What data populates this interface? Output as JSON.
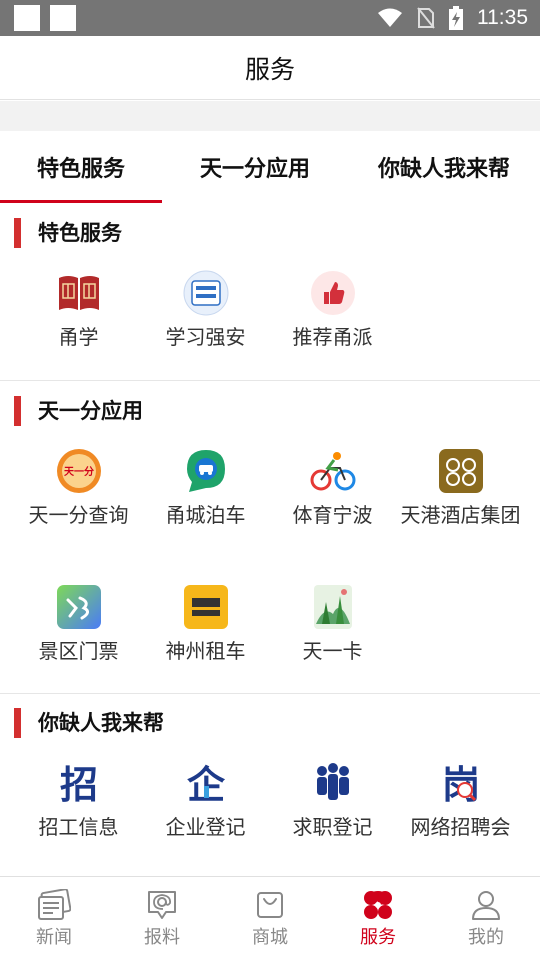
{
  "status_bar": {
    "time": "11:35"
  },
  "header": {
    "title": "服务"
  },
  "tabs": [
    {
      "label": "特色服务",
      "active": true
    },
    {
      "label": "天一分应用",
      "active": false
    },
    {
      "label": "你缺人我来帮",
      "active": false
    }
  ],
  "sections": [
    {
      "title": "特色服务",
      "items": [
        {
          "label": "甬学",
          "icon": "book-icon"
        },
        {
          "label": "学习强安",
          "icon": "study-safety-icon"
        },
        {
          "label": "推荐甬派",
          "icon": "thumbs-up-icon"
        }
      ]
    },
    {
      "title": "天一分应用",
      "items": [
        {
          "label": "天一分查询",
          "icon": "tianyifen-icon",
          "icon_text": "天一分"
        },
        {
          "label": "甬城泊车",
          "icon": "parking-icon"
        },
        {
          "label": "体育宁波",
          "icon": "cycling-icon"
        },
        {
          "label": "天港酒店集团",
          "icon": "hotel-icon"
        },
        {
          "label": "景区门票",
          "icon": "ticket-icon"
        },
        {
          "label": "神州租车",
          "icon": "car-rental-icon"
        },
        {
          "label": "天一卡",
          "icon": "card-icon"
        }
      ]
    },
    {
      "title": "你缺人我来帮",
      "items": [
        {
          "label": "招工信息",
          "icon": "recruit-icon",
          "icon_text": "招"
        },
        {
          "label": "企业登记",
          "icon": "enterprise-icon",
          "icon_text": "企"
        },
        {
          "label": "求职登记",
          "icon": "job-seeker-icon"
        },
        {
          "label": "网络招聘会",
          "icon": "online-fair-icon",
          "icon_text": "岗"
        }
      ]
    }
  ],
  "bottom_nav": [
    {
      "label": "新闻",
      "icon": "news-icon",
      "active": false
    },
    {
      "label": "报料",
      "icon": "report-icon",
      "active": false
    },
    {
      "label": "商城",
      "icon": "shop-icon",
      "active": false
    },
    {
      "label": "服务",
      "icon": "service-icon",
      "active": true
    },
    {
      "label": "我的",
      "icon": "profile-icon",
      "active": false
    }
  ],
  "colors": {
    "accent": "#d0021b",
    "section_bar": "#d32f2f",
    "status_bar": "#757575",
    "recruit_blue": "#1d3a8a"
  }
}
